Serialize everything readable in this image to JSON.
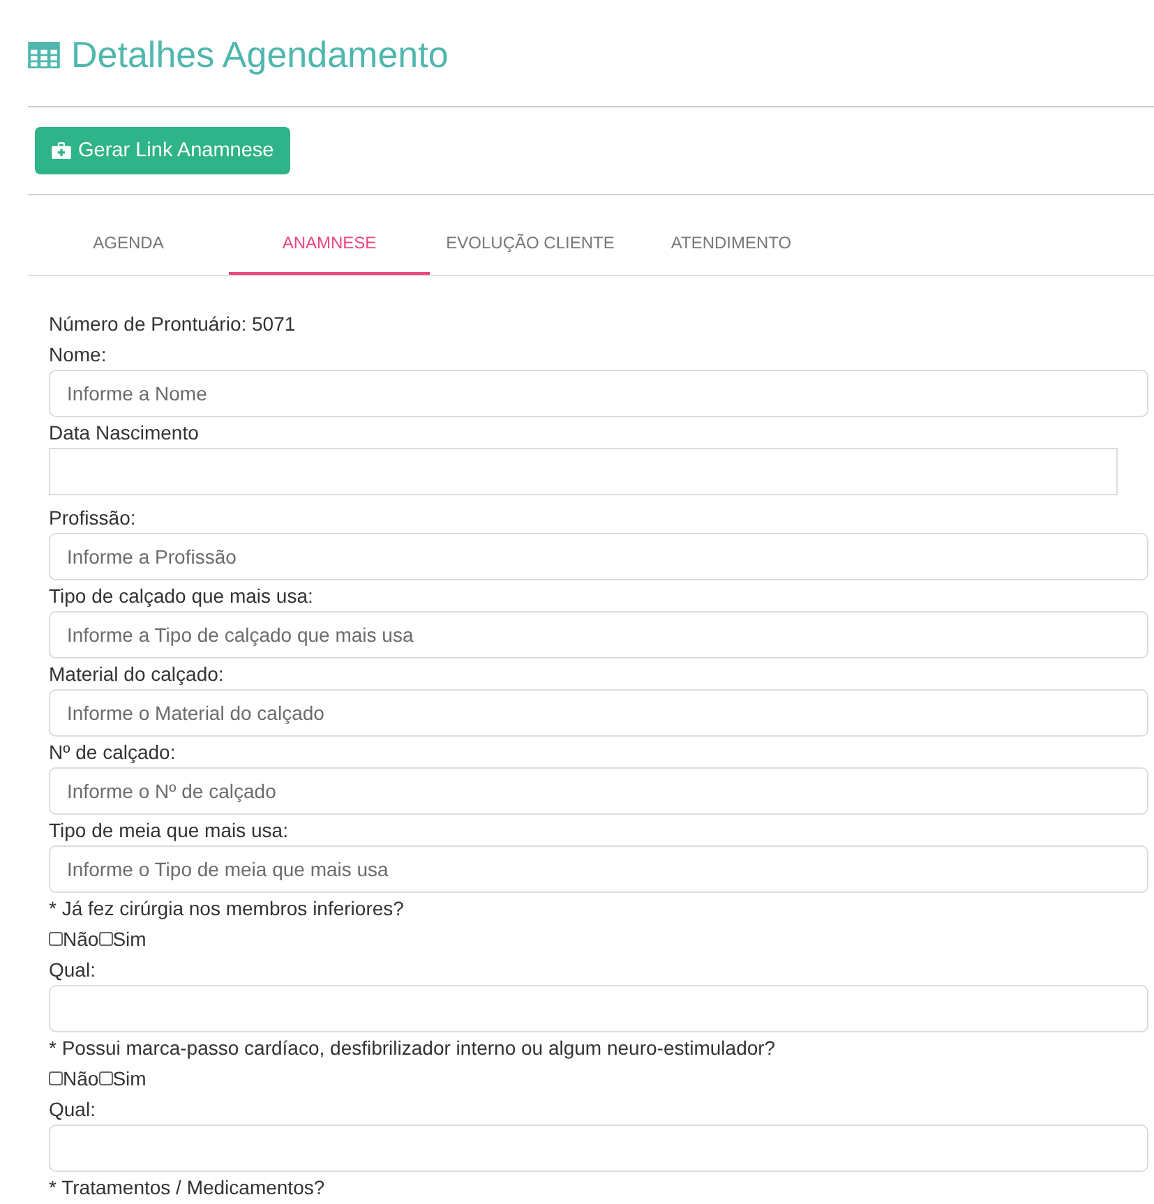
{
  "title": "Detalhes Agendamento",
  "action_button": {
    "label": "Gerar Link Anamnese"
  },
  "tabs": [
    {
      "label": "AGENDA",
      "selected": false
    },
    {
      "label": "ANAMNESE",
      "selected": true
    },
    {
      "label": "EVOLUÇÃO CLIENTE",
      "selected": false
    },
    {
      "label": "ATENDIMENTO",
      "selected": false
    }
  ],
  "record_number": "Número de Prontuário: 5071",
  "fields": [
    {
      "kind": "text",
      "label": "Nome:",
      "placeholder": "Informe a Nome"
    },
    {
      "kind": "date",
      "label": "Data Nascimento"
    },
    {
      "kind": "text",
      "label": "Profissão:",
      "placeholder": "Informe a Profissão"
    },
    {
      "kind": "text",
      "label": "Tipo de calçado que mais usa:",
      "placeholder": "Informe a Tipo de calçado que mais usa"
    },
    {
      "kind": "text",
      "label": "Material do calçado:",
      "placeholder": "Informe o Material do calçado"
    },
    {
      "kind": "text",
      "label": "Nº de calçado:",
      "placeholder": "Informe o Nº de calçado"
    },
    {
      "kind": "text",
      "label": "Tipo de meia que mais usa:",
      "placeholder": "Informe o Tipo de meia que mais usa"
    },
    {
      "kind": "question",
      "label": "* Já fez cirúrgia nos membros inferiores?",
      "options": [
        {
          "label": "Não",
          "checked": false
        },
        {
          "label": "Sim",
          "checked": false
        }
      ]
    },
    {
      "kind": "text",
      "label": "Qual:"
    },
    {
      "kind": "question",
      "label": "* Possui marca-passo cardíaco, desfibrilizador interno ou algum neuro-estimulador?",
      "options": [
        {
          "label": "Não",
          "checked": false
        },
        {
          "label": "Sim",
          "checked": false
        }
      ]
    },
    {
      "kind": "text",
      "label": "Qual:"
    },
    {
      "kind": "heading",
      "label": "* Tratamentos / Medicamentos?"
    }
  ]
}
